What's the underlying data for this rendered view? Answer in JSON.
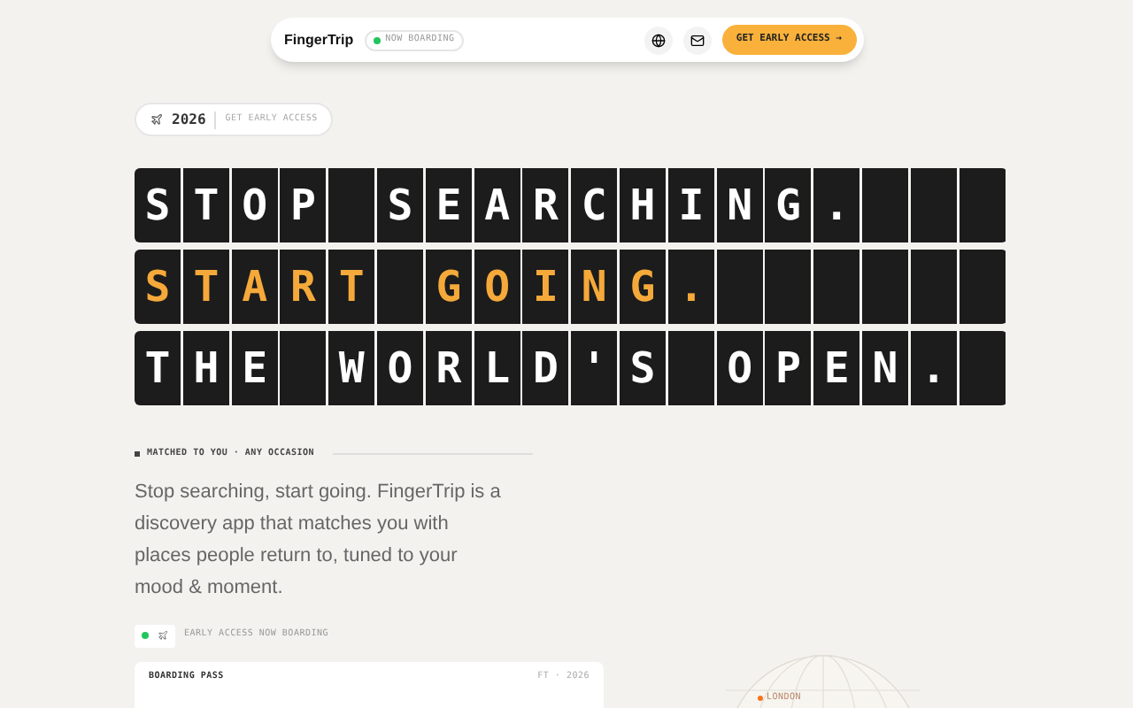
{
  "nav": {
    "brand": "FingerTrip",
    "status": {
      "label": "NOW BOARDING",
      "color": "#22c55e"
    },
    "cta": "GET EARLY ACCESS →"
  },
  "badge": {
    "year": "2026",
    "label": "GET EARLY ACCESS"
  },
  "board": [
    {
      "text": "STOP SEARCHING.",
      "accent": false
    },
    {
      "text": "START GOING.",
      "accent": true
    },
    {
      "text": "THE WORLD'S OPEN.",
      "accent": false
    }
  ],
  "tagline": "MATCHED TO YOU · ANY OCCASION",
  "intro": "Stop searching, start going. FingerTrip is a discovery app that matches you with places people return to, tuned to your mood & moment.",
  "early": {
    "label": "EARLY ACCESS NOW BOARDING",
    "color": "#22c55e"
  },
  "pass": {
    "title": "BOARDING PASS",
    "code": "FT · 2026"
  },
  "globe": {
    "city": "LONDON",
    "color": "#f97316"
  }
}
